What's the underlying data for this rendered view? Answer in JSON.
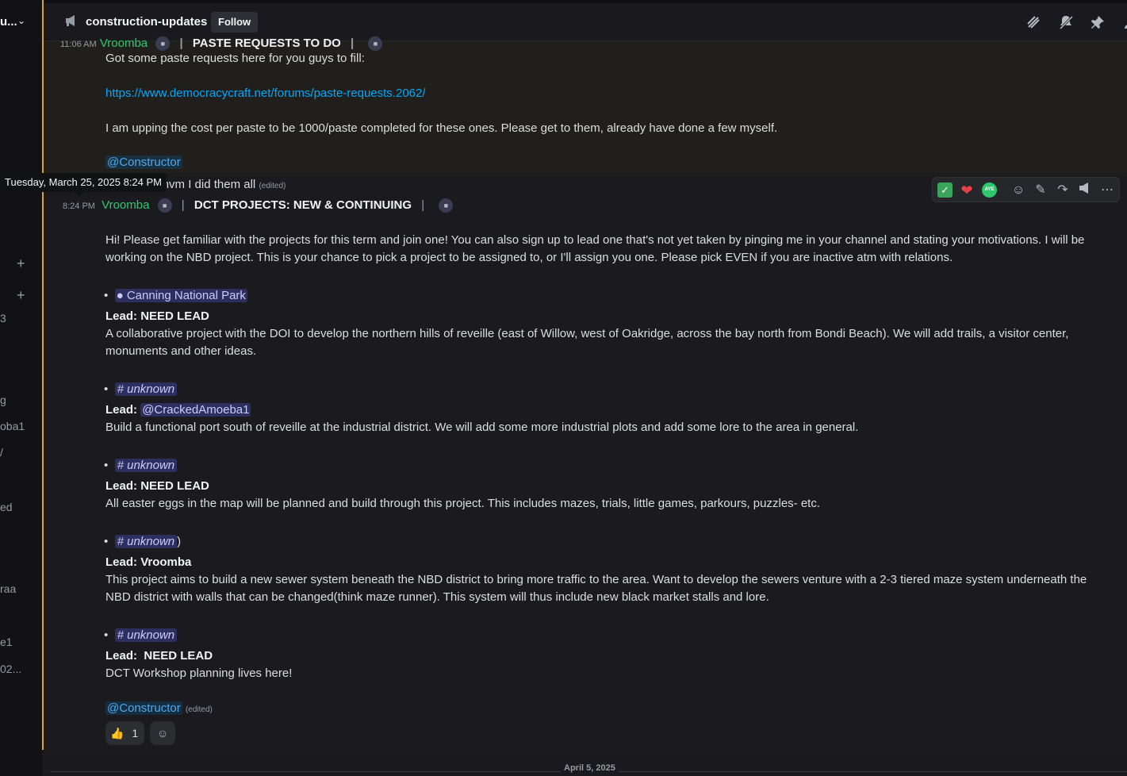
{
  "sidebar": {
    "server_name": "u...",
    "fragments": [
      "3",
      "g",
      "oba1",
      "/",
      "ed",
      "raa",
      "e1",
      "02..."
    ]
  },
  "header": {
    "channel_name": "construction-updates",
    "follow_label": "Follow",
    "icons": [
      "threads-icon",
      "notifications-muted-icon",
      "pin-icon",
      "members-icon"
    ]
  },
  "previous_message": {
    "timestamp": "11:06 AM",
    "author": "Vroomba",
    "title": "PASTE REQUESTS TO DO",
    "line1": "Got some paste requests here for you guys to fill:",
    "link": "https://www.democracycraft.net/forums/paste-requests.2062/",
    "line2": "I am upping the cost per paste to be 1000/paste completed for these ones. Please get to them, already have done a few myself.",
    "mention": "@Constructor",
    "followup": "how what, nvm I did them all",
    "edited": "(edited)"
  },
  "tooltip": "Tuesday, March 25, 2025 8:24 PM",
  "toolbar": {
    "buttons": [
      "check-reaction",
      "heart-reaction",
      "aye-reaction",
      "add-reaction",
      "edit",
      "reply",
      "publish",
      "more"
    ],
    "aye_label": "AYE"
  },
  "message": {
    "timestamp": "8:24 PM",
    "author": "Vroomba",
    "title": "DCT PROJECTS: NEW & CONTINUING",
    "intro1": "Hi! Please get familiar with the projects for this term and join one! You can also sign up to lead one that's not yet taken by pinging me in your channel and stating your motivations. I will be",
    "intro2": "working on the NBD project.  This is your chance to pick a project to be assigned to, or I'll assign you one. Please pick EVEN if you are inactive atm with relations.",
    "projects": [
      {
        "channel": "Canning National Park",
        "lead_label": "Lead:",
        "lead": "NEED LEAD",
        "desc1": "A collaborative project with the DOI to develop the northern hills of reveille (east of Willow, west of Oakridge, across the bay north from Bondi Beach). We will add trails, a visitor center,",
        "desc2": "monuments and other ideas."
      },
      {
        "channel": "# unknown",
        "lead_label": "Lead:",
        "lead": "@CrackedAmoeba1",
        "desc1": "Build a functional port south of reveille at the industrial district. We will add some more industrial plots and add some lore to the area in general."
      },
      {
        "channel": "# unknown",
        "lead_label": "Lead:",
        "lead": "NEED LEAD",
        "desc1": "All easter eggs in the map will be planned and build through this project. This includes mazes, trials, little games, parkours, puzzles- etc."
      },
      {
        "channel": "# unknown",
        "suffix": ")",
        "lead_label": "Lead:",
        "lead": "Vroomba",
        "desc1": "This project aims to build a new sewer system beneath the NBD district to bring more traffic to the area. Want to develop the sewers venture with a 2-3 tiered maze system underneath the",
        "desc2": "NBD district with walls that can be changed(think maze runner). This system will thus include new black market stalls and lore."
      },
      {
        "channel": "# unknown",
        "lead_label": "Lead:",
        "lead": "NEED LEAD",
        "desc1": "DCT Workshop planning lives here!"
      }
    ],
    "mention": "@Constructor",
    "edited": "(edited)",
    "reaction_count": "1"
  },
  "date_divider": "April 5, 2025"
}
